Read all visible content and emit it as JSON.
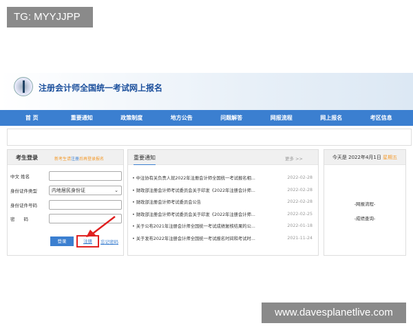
{
  "watermarks": {
    "top": "TG: MYYJJPP",
    "bottom": "www.davesplanetlive.com"
  },
  "header": {
    "title": "注册会计师全国统一考试网上报名"
  },
  "nav": [
    "首 页",
    "重要通知",
    "政策制度",
    "地方公告",
    "问题解答",
    "网报流程",
    "网上报名",
    "考区信息"
  ],
  "login": {
    "title": "考生登录",
    "hint_pre": "新考生请",
    "hint_link": "注册",
    "hint_post": "后再登录报名",
    "fields": [
      {
        "label": "中文 姓名",
        "value": ""
      },
      {
        "label": "身份证件类型",
        "value": "内地居民身份证"
      },
      {
        "label": "身份证件号码",
        "value": ""
      },
      {
        "label": "密　　码",
        "value": ""
      }
    ],
    "login_button": "登录",
    "register_link": "注册",
    "forgot_link": "忘记密码"
  },
  "notices": {
    "title": "重要通知",
    "more": "更多 >>",
    "items": [
      {
        "title": "中注协有关负责人就2022年注册会计师全国统一考试报名相...",
        "date": "2022-02-28"
      },
      {
        "title": "财政部注册会计师考试委员会关于印发《2022年注册会计师...",
        "date": "2022-02-28"
      },
      {
        "title": "财政部注册会计师考试委员会公告",
        "date": "2022-02-28"
      },
      {
        "title": "财政部注册会计师考试委员会关于印发《2022年注册会计师...",
        "date": "2022-02-25"
      },
      {
        "title": "关于公布2021年注册会计师全国统一考试成绩复核结果的公...",
        "date": "2022-01-18"
      },
      {
        "title": "关于发布2022年注册会计师全国统一考试报名时间和考试时...",
        "date": "2021-11-24"
      }
    ]
  },
  "side": {
    "today": "今天是 2022年4月1日",
    "weekday": "星期五",
    "links": [
      "-网报流程-",
      "-成绩查询-"
    ]
  }
}
